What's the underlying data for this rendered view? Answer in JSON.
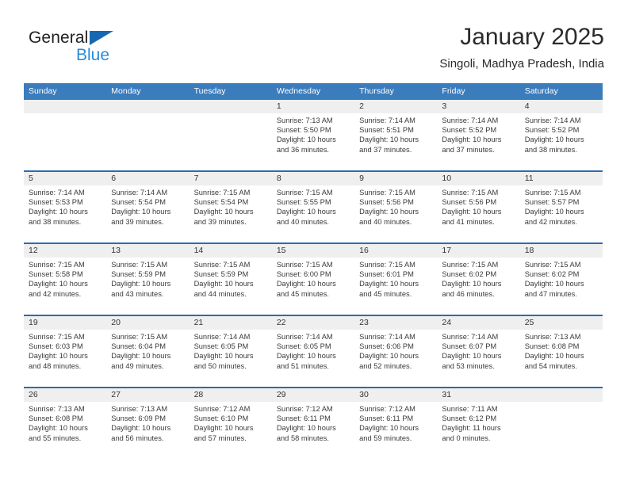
{
  "brand": {
    "name_top": "General",
    "name_bottom": "Blue",
    "triangle_color": "#1668b3",
    "blue_text_color": "#2b8ad6"
  },
  "header": {
    "title": "January 2025",
    "subtitle": "Singoli, Madhya Pradesh, India"
  },
  "theme": {
    "header_blue": "#3b7cbd",
    "row_rule_blue": "#2a6cb0",
    "date_strip_gray": "#efefef",
    "text_color": "#3a3a3a"
  },
  "calendar": {
    "weekday_headers": [
      "Sunday",
      "Monday",
      "Tuesday",
      "Wednesday",
      "Thursday",
      "Friday",
      "Saturday"
    ],
    "weeks": [
      [
        {
          "date": "",
          "lines": []
        },
        {
          "date": "",
          "lines": []
        },
        {
          "date": "",
          "lines": []
        },
        {
          "date": "1",
          "lines": [
            "Sunrise: 7:13 AM",
            "Sunset: 5:50 PM",
            "Daylight: 10 hours",
            "and 36 minutes."
          ]
        },
        {
          "date": "2",
          "lines": [
            "Sunrise: 7:14 AM",
            "Sunset: 5:51 PM",
            "Daylight: 10 hours",
            "and 37 minutes."
          ]
        },
        {
          "date": "3",
          "lines": [
            "Sunrise: 7:14 AM",
            "Sunset: 5:52 PM",
            "Daylight: 10 hours",
            "and 37 minutes."
          ]
        },
        {
          "date": "4",
          "lines": [
            "Sunrise: 7:14 AM",
            "Sunset: 5:52 PM",
            "Daylight: 10 hours",
            "and 38 minutes."
          ]
        }
      ],
      [
        {
          "date": "5",
          "lines": [
            "Sunrise: 7:14 AM",
            "Sunset: 5:53 PM",
            "Daylight: 10 hours",
            "and 38 minutes."
          ]
        },
        {
          "date": "6",
          "lines": [
            "Sunrise: 7:14 AM",
            "Sunset: 5:54 PM",
            "Daylight: 10 hours",
            "and 39 minutes."
          ]
        },
        {
          "date": "7",
          "lines": [
            "Sunrise: 7:15 AM",
            "Sunset: 5:54 PM",
            "Daylight: 10 hours",
            "and 39 minutes."
          ]
        },
        {
          "date": "8",
          "lines": [
            "Sunrise: 7:15 AM",
            "Sunset: 5:55 PM",
            "Daylight: 10 hours",
            "and 40 minutes."
          ]
        },
        {
          "date": "9",
          "lines": [
            "Sunrise: 7:15 AM",
            "Sunset: 5:56 PM",
            "Daylight: 10 hours",
            "and 40 minutes."
          ]
        },
        {
          "date": "10",
          "lines": [
            "Sunrise: 7:15 AM",
            "Sunset: 5:56 PM",
            "Daylight: 10 hours",
            "and 41 minutes."
          ]
        },
        {
          "date": "11",
          "lines": [
            "Sunrise: 7:15 AM",
            "Sunset: 5:57 PM",
            "Daylight: 10 hours",
            "and 42 minutes."
          ]
        }
      ],
      [
        {
          "date": "12",
          "lines": [
            "Sunrise: 7:15 AM",
            "Sunset: 5:58 PM",
            "Daylight: 10 hours",
            "and 42 minutes."
          ]
        },
        {
          "date": "13",
          "lines": [
            "Sunrise: 7:15 AM",
            "Sunset: 5:59 PM",
            "Daylight: 10 hours",
            "and 43 minutes."
          ]
        },
        {
          "date": "14",
          "lines": [
            "Sunrise: 7:15 AM",
            "Sunset: 5:59 PM",
            "Daylight: 10 hours",
            "and 44 minutes."
          ]
        },
        {
          "date": "15",
          "lines": [
            "Sunrise: 7:15 AM",
            "Sunset: 6:00 PM",
            "Daylight: 10 hours",
            "and 45 minutes."
          ]
        },
        {
          "date": "16",
          "lines": [
            "Sunrise: 7:15 AM",
            "Sunset: 6:01 PM",
            "Daylight: 10 hours",
            "and 45 minutes."
          ]
        },
        {
          "date": "17",
          "lines": [
            "Sunrise: 7:15 AM",
            "Sunset: 6:02 PM",
            "Daylight: 10 hours",
            "and 46 minutes."
          ]
        },
        {
          "date": "18",
          "lines": [
            "Sunrise: 7:15 AM",
            "Sunset: 6:02 PM",
            "Daylight: 10 hours",
            "and 47 minutes."
          ]
        }
      ],
      [
        {
          "date": "19",
          "lines": [
            "Sunrise: 7:15 AM",
            "Sunset: 6:03 PM",
            "Daylight: 10 hours",
            "and 48 minutes."
          ]
        },
        {
          "date": "20",
          "lines": [
            "Sunrise: 7:15 AM",
            "Sunset: 6:04 PM",
            "Daylight: 10 hours",
            "and 49 minutes."
          ]
        },
        {
          "date": "21",
          "lines": [
            "Sunrise: 7:14 AM",
            "Sunset: 6:05 PM",
            "Daylight: 10 hours",
            "and 50 minutes."
          ]
        },
        {
          "date": "22",
          "lines": [
            "Sunrise: 7:14 AM",
            "Sunset: 6:05 PM",
            "Daylight: 10 hours",
            "and 51 minutes."
          ]
        },
        {
          "date": "23",
          "lines": [
            "Sunrise: 7:14 AM",
            "Sunset: 6:06 PM",
            "Daylight: 10 hours",
            "and 52 minutes."
          ]
        },
        {
          "date": "24",
          "lines": [
            "Sunrise: 7:14 AM",
            "Sunset: 6:07 PM",
            "Daylight: 10 hours",
            "and 53 minutes."
          ]
        },
        {
          "date": "25",
          "lines": [
            "Sunrise: 7:13 AM",
            "Sunset: 6:08 PM",
            "Daylight: 10 hours",
            "and 54 minutes."
          ]
        }
      ],
      [
        {
          "date": "26",
          "lines": [
            "Sunrise: 7:13 AM",
            "Sunset: 6:08 PM",
            "Daylight: 10 hours",
            "and 55 minutes."
          ]
        },
        {
          "date": "27",
          "lines": [
            "Sunrise: 7:13 AM",
            "Sunset: 6:09 PM",
            "Daylight: 10 hours",
            "and 56 minutes."
          ]
        },
        {
          "date": "28",
          "lines": [
            "Sunrise: 7:12 AM",
            "Sunset: 6:10 PM",
            "Daylight: 10 hours",
            "and 57 minutes."
          ]
        },
        {
          "date": "29",
          "lines": [
            "Sunrise: 7:12 AM",
            "Sunset: 6:11 PM",
            "Daylight: 10 hours",
            "and 58 minutes."
          ]
        },
        {
          "date": "30",
          "lines": [
            "Sunrise: 7:12 AM",
            "Sunset: 6:11 PM",
            "Daylight: 10 hours",
            "and 59 minutes."
          ]
        },
        {
          "date": "31",
          "lines": [
            "Sunrise: 7:11 AM",
            "Sunset: 6:12 PM",
            "Daylight: 11 hours",
            "and 0 minutes."
          ]
        },
        {
          "date": "",
          "lines": []
        }
      ]
    ]
  }
}
